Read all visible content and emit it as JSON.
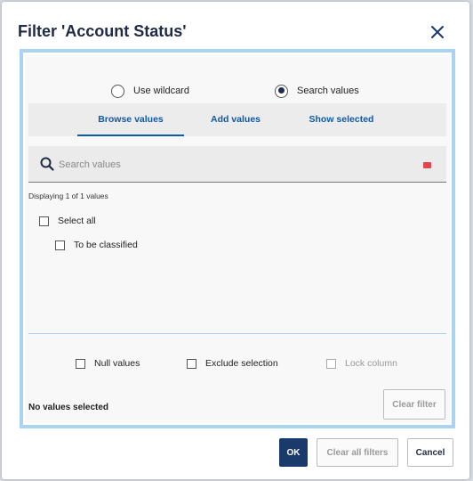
{
  "dialog": {
    "title": "Filter 'Account Status'",
    "close_icon": "close-icon"
  },
  "mode": {
    "wildcard_label": "Use wildcard",
    "search_label": "Search values",
    "selected": "search"
  },
  "tabs": [
    {
      "label": "Browse values",
      "active": true
    },
    {
      "label": "Add values",
      "active": false
    },
    {
      "label": "Show selected",
      "active": false
    }
  ],
  "search": {
    "placeholder": "Search values",
    "value": "",
    "icon": "search-icon"
  },
  "results": {
    "count_text": "Displaying 1 of 1 values",
    "select_all_label": "Select all",
    "items": [
      {
        "label": "To be classified",
        "checked": false
      }
    ]
  },
  "options": {
    "null_values_label": "Null values",
    "exclude_selection_label": "Exclude selection",
    "lock_column_label": "Lock column"
  },
  "status": {
    "text": "No values selected",
    "clear_filter_label": "Clear filter"
  },
  "footer": {
    "ok_label": "OK",
    "clear_all_label": "Clear all filters",
    "cancel_label": "Cancel"
  },
  "colors": {
    "accent": "#0e5aa7",
    "primary_button": "#1a3a6b",
    "panel_border": "#a9d3f0",
    "clear_indicator": "#e0474c"
  }
}
